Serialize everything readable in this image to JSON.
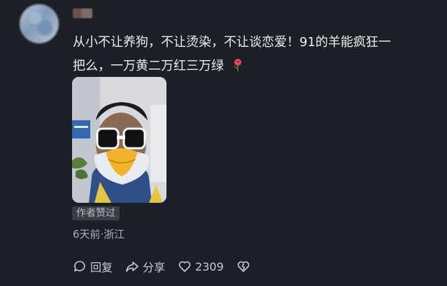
{
  "comment": {
    "text_line1": "从小不让养狗，不让烫染，不让谈恋爱！91的羊能疯狂一",
    "text_line2": "把么，一万黄二万红三万绿",
    "emoji_icon": "rose-icon",
    "badge": "作者赞过",
    "meta": "6天前·浙江"
  },
  "actions": {
    "reply_label": "回复",
    "share_label": "分享",
    "like_count": "2309",
    "like_icon": "heart-icon",
    "dislike_icon": "broken-heart-icon"
  },
  "colors": {
    "background": "#1d1f27",
    "text": "#eceef1",
    "muted": "#aeb1b8",
    "badge_bg": "#3a3d46"
  }
}
